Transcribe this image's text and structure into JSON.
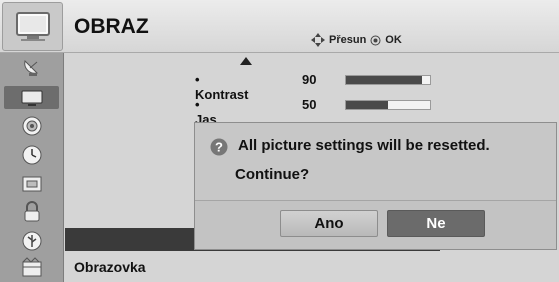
{
  "header": {
    "icon": "tv-picture-icon",
    "title": "OBRAZ",
    "hint": {
      "move_icon": "dpad-icon",
      "move_label": "Přesun",
      "ok_icon": "ok-button-icon",
      "ok_label": "OK"
    }
  },
  "sidebar": {
    "items": [
      {
        "icon": "satellite-dish-icon",
        "active": false
      },
      {
        "icon": "picture-icon",
        "active": true
      },
      {
        "icon": "speaker-icon",
        "active": false
      },
      {
        "icon": "clock-icon",
        "active": false
      },
      {
        "icon": "gear-box-icon",
        "active": false
      },
      {
        "icon": "lock-icon",
        "active": false
      },
      {
        "icon": "usb-icon",
        "active": false
      },
      {
        "icon": "film-icon",
        "active": false
      }
    ]
  },
  "settings": [
    {
      "label": "• Kontrast",
      "value": "90",
      "level": 0.9
    },
    {
      "label": "• Jas",
      "value": "50",
      "level": 0.5
    }
  ],
  "bottom_item": "Obrazovka",
  "dialog": {
    "icon": "question-icon",
    "message": "All picture settings will be resetted.",
    "question": "Continue?",
    "buttons": {
      "yes": "Ano",
      "no": "Ne"
    },
    "focused": "no"
  }
}
